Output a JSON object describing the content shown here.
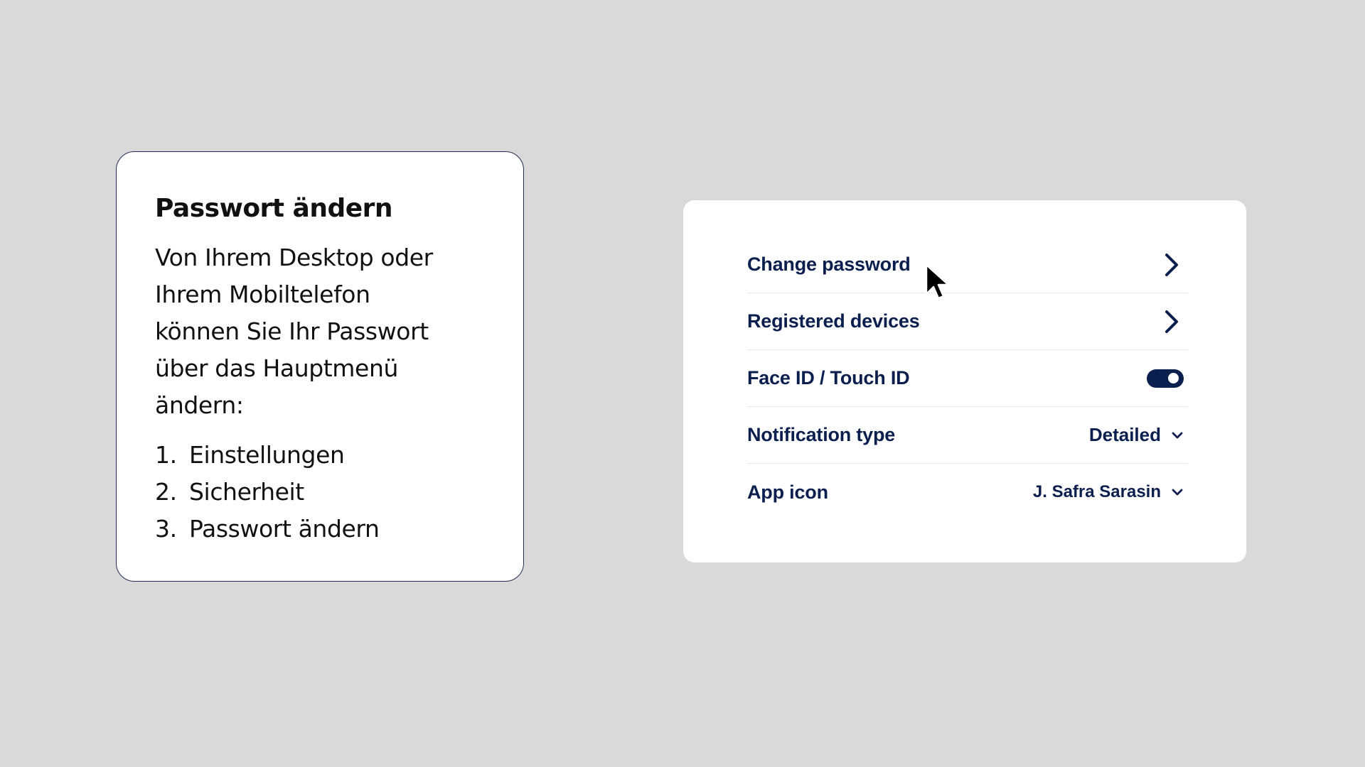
{
  "info_card": {
    "title": "Passwort ändern",
    "body_lines": [
      "Von Ihrem Desktop oder",
      "Ihrem Mobiltelefon",
      "können Sie Ihr Passwort",
      "über das Hauptmenü",
      "ändern:"
    ],
    "steps": [
      {
        "num": "1.",
        "label": "Einstellungen"
      },
      {
        "num": "2.",
        "label": "Sicherheit"
      },
      {
        "num": "3.",
        "label": "Passwort ändern"
      }
    ]
  },
  "settings": {
    "rows": [
      {
        "label": "Change password",
        "control": "chevron-right-icon"
      },
      {
        "label": "Registered devices",
        "control": "chevron-right-icon"
      },
      {
        "label": "Face ID / Touch ID",
        "control": "toggle",
        "toggle_on": true
      },
      {
        "label": "Notification type",
        "control": "select",
        "value": "Detailed"
      },
      {
        "label": "App icon",
        "control": "select",
        "value": "J. Safra Sarasin"
      }
    ]
  },
  "colors": {
    "background": "#d9d9d9",
    "card": "#ffffff",
    "navy": "#0b1f4f",
    "card_border": "#1f2d4f",
    "divider": "#e6e6e6"
  },
  "icons": {
    "cursor": "mouse-pointer-icon",
    "row_arrow": "chevron-right-icon",
    "select_arrow": "chevron-down-icon"
  }
}
